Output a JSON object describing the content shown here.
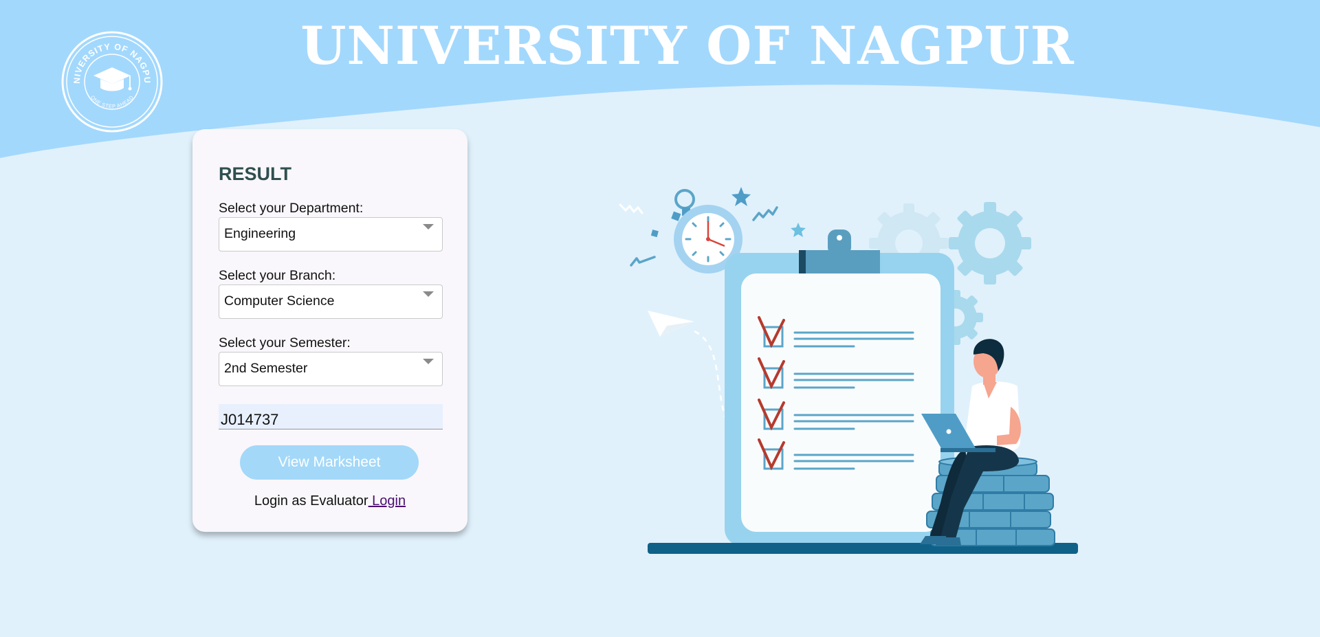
{
  "header": {
    "title": "UNIVERSITY OF NAGPUR",
    "logo_text_top": "UNIVERSITY OF NAGPUR",
    "logo_text_bottom": "ONE STEP AHEAD"
  },
  "result_form": {
    "title": "RESULT",
    "department": {
      "label": "Select your Department:",
      "value": "Engineering"
    },
    "branch": {
      "label": "Select your Branch:",
      "value": "Computer Science"
    },
    "semester": {
      "label": "Select your Semester:",
      "value": "2nd Semester"
    },
    "registration_number": "J014737",
    "view_button": "View Marksheet",
    "login_prompt": "Login as Evaluator",
    "login_link": " Login"
  },
  "colors": {
    "page_background": "#e0f1fc",
    "header_band": "#a3d8fd",
    "card_background": "#f9f7fb",
    "button": "#a3d8f8",
    "title_text": "#2f4f4f",
    "link": "#4b0f72"
  }
}
